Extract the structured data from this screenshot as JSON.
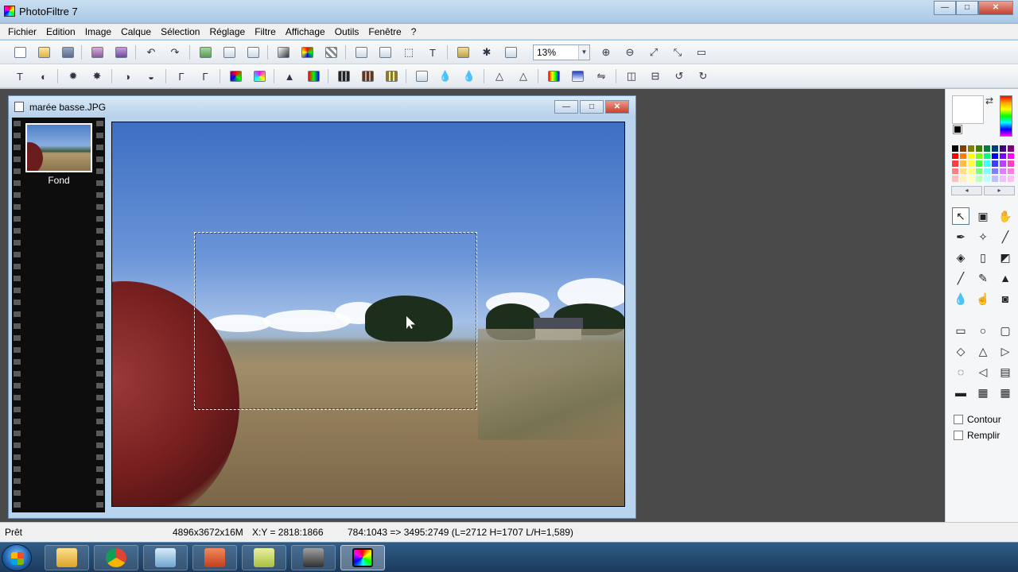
{
  "app": {
    "title": "PhotoFiltre 7"
  },
  "window_controls": {
    "minimize": "—",
    "maximize": "□",
    "close": "✕"
  },
  "menu": [
    "Fichier",
    "Edition",
    "Image",
    "Calque",
    "Sélection",
    "Réglage",
    "Filtre",
    "Affichage",
    "Outils",
    "Fenêtre",
    "?"
  ],
  "toolbar": {
    "zoom_value": "13%",
    "zoom_arrow": "▼"
  },
  "document": {
    "title": "marée basse.JPG"
  },
  "layers": [
    {
      "label": "Fond"
    }
  ],
  "right_panel": {
    "swap_icon": "⇄",
    "palette_prev": "◂",
    "palette_next": "▸",
    "options": [
      {
        "label": "Contour"
      },
      {
        "label": "Remplir"
      }
    ],
    "palette_colors": [
      "#000000",
      "#7f3f00",
      "#7f7f00",
      "#3f7f00",
      "#007f3f",
      "#003f7f",
      "#3f007f",
      "#7f007f",
      "#ff0000",
      "#ff7f00",
      "#ffff00",
      "#7fff00",
      "#00ff7f",
      "#0000ff",
      "#7f00ff",
      "#ff00ff",
      "#ff3f3f",
      "#ffbf3f",
      "#ffff3f",
      "#3fff3f",
      "#3fffff",
      "#3f3fff",
      "#bf3fff",
      "#ff3fbf",
      "#ff7f7f",
      "#ffdf7f",
      "#ffff7f",
      "#7fff7f",
      "#7fffff",
      "#7f7fff",
      "#df7fff",
      "#ff7fdf",
      "#ffbfbf",
      "#ffefbf",
      "#ffffbf",
      "#bfffbf",
      "#bfffff",
      "#bfbfff",
      "#efbfff",
      "#ffbfef"
    ]
  },
  "status": {
    "state": "Prêt",
    "image_size": "4896x3672x16M",
    "cursor_pos": "X:Y = 2818:1866",
    "selection": "784:1043 => 3495:2749 (L=2712  H=1707  L/H=1,589)"
  },
  "colors": {
    "workspace": "#4a4a4a",
    "titlebar": "#b5d0ea"
  }
}
